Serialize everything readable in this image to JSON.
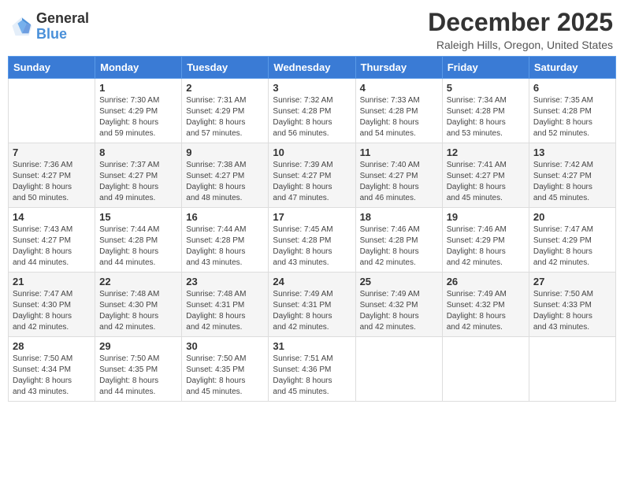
{
  "header": {
    "logo_general": "General",
    "logo_blue": "Blue",
    "month_title": "December 2025",
    "location": "Raleigh Hills, Oregon, United States"
  },
  "days_of_week": [
    "Sunday",
    "Monday",
    "Tuesday",
    "Wednesday",
    "Thursday",
    "Friday",
    "Saturday"
  ],
  "weeks": [
    [
      {
        "day": "",
        "info": ""
      },
      {
        "day": "1",
        "info": "Sunrise: 7:30 AM\nSunset: 4:29 PM\nDaylight: 8 hours\nand 59 minutes."
      },
      {
        "day": "2",
        "info": "Sunrise: 7:31 AM\nSunset: 4:29 PM\nDaylight: 8 hours\nand 57 minutes."
      },
      {
        "day": "3",
        "info": "Sunrise: 7:32 AM\nSunset: 4:28 PM\nDaylight: 8 hours\nand 56 minutes."
      },
      {
        "day": "4",
        "info": "Sunrise: 7:33 AM\nSunset: 4:28 PM\nDaylight: 8 hours\nand 54 minutes."
      },
      {
        "day": "5",
        "info": "Sunrise: 7:34 AM\nSunset: 4:28 PM\nDaylight: 8 hours\nand 53 minutes."
      },
      {
        "day": "6",
        "info": "Sunrise: 7:35 AM\nSunset: 4:28 PM\nDaylight: 8 hours\nand 52 minutes."
      }
    ],
    [
      {
        "day": "7",
        "info": "Sunrise: 7:36 AM\nSunset: 4:27 PM\nDaylight: 8 hours\nand 50 minutes."
      },
      {
        "day": "8",
        "info": "Sunrise: 7:37 AM\nSunset: 4:27 PM\nDaylight: 8 hours\nand 49 minutes."
      },
      {
        "day": "9",
        "info": "Sunrise: 7:38 AM\nSunset: 4:27 PM\nDaylight: 8 hours\nand 48 minutes."
      },
      {
        "day": "10",
        "info": "Sunrise: 7:39 AM\nSunset: 4:27 PM\nDaylight: 8 hours\nand 47 minutes."
      },
      {
        "day": "11",
        "info": "Sunrise: 7:40 AM\nSunset: 4:27 PM\nDaylight: 8 hours\nand 46 minutes."
      },
      {
        "day": "12",
        "info": "Sunrise: 7:41 AM\nSunset: 4:27 PM\nDaylight: 8 hours\nand 45 minutes."
      },
      {
        "day": "13",
        "info": "Sunrise: 7:42 AM\nSunset: 4:27 PM\nDaylight: 8 hours\nand 45 minutes."
      }
    ],
    [
      {
        "day": "14",
        "info": "Sunrise: 7:43 AM\nSunset: 4:27 PM\nDaylight: 8 hours\nand 44 minutes."
      },
      {
        "day": "15",
        "info": "Sunrise: 7:44 AM\nSunset: 4:28 PM\nDaylight: 8 hours\nand 44 minutes."
      },
      {
        "day": "16",
        "info": "Sunrise: 7:44 AM\nSunset: 4:28 PM\nDaylight: 8 hours\nand 43 minutes."
      },
      {
        "day": "17",
        "info": "Sunrise: 7:45 AM\nSunset: 4:28 PM\nDaylight: 8 hours\nand 43 minutes."
      },
      {
        "day": "18",
        "info": "Sunrise: 7:46 AM\nSunset: 4:28 PM\nDaylight: 8 hours\nand 42 minutes."
      },
      {
        "day": "19",
        "info": "Sunrise: 7:46 AM\nSunset: 4:29 PM\nDaylight: 8 hours\nand 42 minutes."
      },
      {
        "day": "20",
        "info": "Sunrise: 7:47 AM\nSunset: 4:29 PM\nDaylight: 8 hours\nand 42 minutes."
      }
    ],
    [
      {
        "day": "21",
        "info": "Sunrise: 7:47 AM\nSunset: 4:30 PM\nDaylight: 8 hours\nand 42 minutes."
      },
      {
        "day": "22",
        "info": "Sunrise: 7:48 AM\nSunset: 4:30 PM\nDaylight: 8 hours\nand 42 minutes."
      },
      {
        "day": "23",
        "info": "Sunrise: 7:48 AM\nSunset: 4:31 PM\nDaylight: 8 hours\nand 42 minutes."
      },
      {
        "day": "24",
        "info": "Sunrise: 7:49 AM\nSunset: 4:31 PM\nDaylight: 8 hours\nand 42 minutes."
      },
      {
        "day": "25",
        "info": "Sunrise: 7:49 AM\nSunset: 4:32 PM\nDaylight: 8 hours\nand 42 minutes."
      },
      {
        "day": "26",
        "info": "Sunrise: 7:49 AM\nSunset: 4:32 PM\nDaylight: 8 hours\nand 42 minutes."
      },
      {
        "day": "27",
        "info": "Sunrise: 7:50 AM\nSunset: 4:33 PM\nDaylight: 8 hours\nand 43 minutes."
      }
    ],
    [
      {
        "day": "28",
        "info": "Sunrise: 7:50 AM\nSunset: 4:34 PM\nDaylight: 8 hours\nand 43 minutes."
      },
      {
        "day": "29",
        "info": "Sunrise: 7:50 AM\nSunset: 4:35 PM\nDaylight: 8 hours\nand 44 minutes."
      },
      {
        "day": "30",
        "info": "Sunrise: 7:50 AM\nSunset: 4:35 PM\nDaylight: 8 hours\nand 45 minutes."
      },
      {
        "day": "31",
        "info": "Sunrise: 7:51 AM\nSunset: 4:36 PM\nDaylight: 8 hours\nand 45 minutes."
      },
      {
        "day": "",
        "info": ""
      },
      {
        "day": "",
        "info": ""
      },
      {
        "day": "",
        "info": ""
      }
    ]
  ]
}
